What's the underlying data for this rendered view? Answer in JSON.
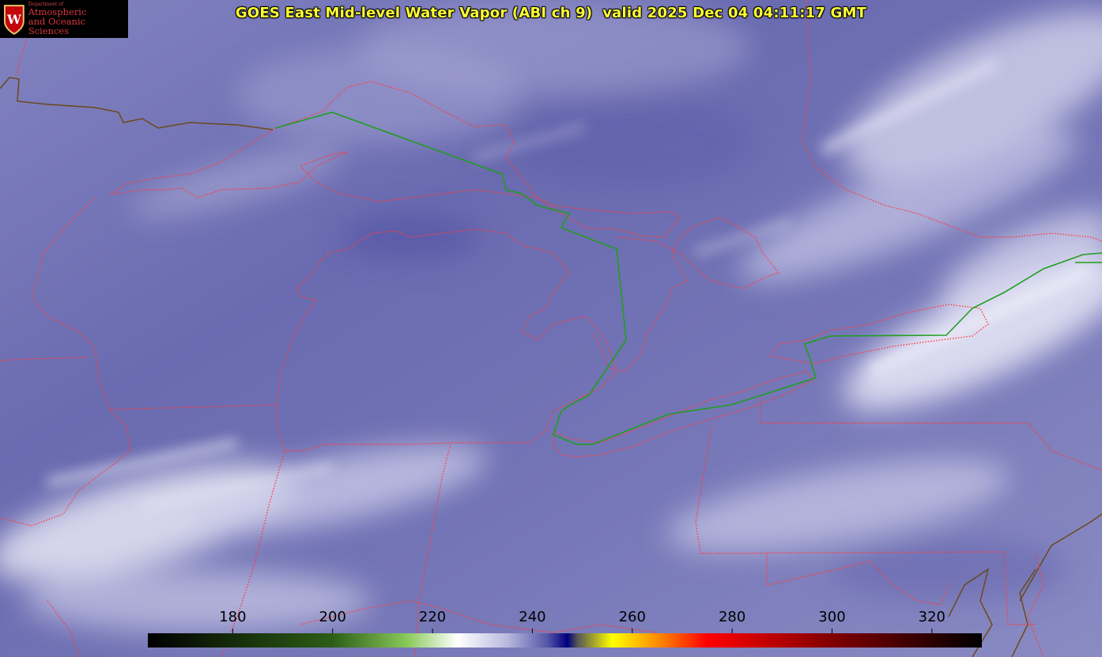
{
  "title": "GOES East Mid-level Water Vapor (ABI ch 9)  valid 2025 Dec 04 04:11:17 GMT",
  "logo": {
    "department": "Department of",
    "line1": "Atmospheric",
    "line2": "and Oceanic Sciences",
    "crest_letter": "W"
  },
  "colorbar": {
    "ticks": [
      "180",
      "200",
      "220",
      "240",
      "260",
      "280",
      "300",
      "320"
    ],
    "stops": [
      {
        "value": 163,
        "color": "#000000"
      },
      {
        "value": 200,
        "color": "#2d5e17"
      },
      {
        "value": 215,
        "color": "#8ac95a"
      },
      {
        "value": 225,
        "color": "#ffffff"
      },
      {
        "value": 235,
        "color": "#b9b9df"
      },
      {
        "value": 243,
        "color": "#5556a8"
      },
      {
        "value": 247,
        "color": "#000080"
      },
      {
        "value": 249,
        "color": "#555555"
      },
      {
        "value": 256,
        "color": "#ffff00"
      },
      {
        "value": 266,
        "color": "#ff8000"
      },
      {
        "value": 275,
        "color": "#ff0000"
      },
      {
        "value": 300,
        "color": "#800000"
      },
      {
        "value": 330,
        "color": "#000000"
      }
    ]
  },
  "colors": {
    "background": "#6f70b2",
    "state_borders": "#ff3b3b",
    "international_border": "#1f9e1f",
    "coastline": "#6a4a1a",
    "title": "#ffff33"
  }
}
